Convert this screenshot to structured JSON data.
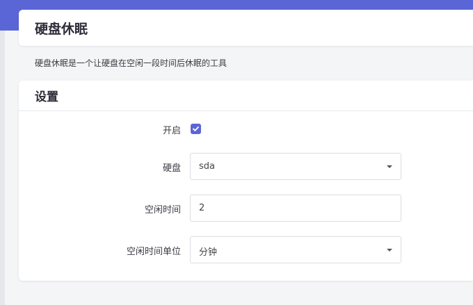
{
  "page": {
    "title": "硬盘休眠",
    "description": "硬盘休眠是一个让硬盘在空闲一段时间后休眠的工具"
  },
  "settings": {
    "title": "设置",
    "enable": {
      "label": "开启",
      "checked": true
    },
    "disk": {
      "label": "硬盘",
      "value": "sda"
    },
    "idle_time": {
      "label": "空闲时间",
      "value": "2"
    },
    "idle_unit": {
      "label": "空闲时间单位",
      "value": "分钟"
    }
  },
  "colors": {
    "accent": "#5b66d6",
    "background": "#f4f5f7"
  },
  "icons": {
    "checkbox": "check-icon",
    "dropdown": "chevron-down-icon"
  }
}
